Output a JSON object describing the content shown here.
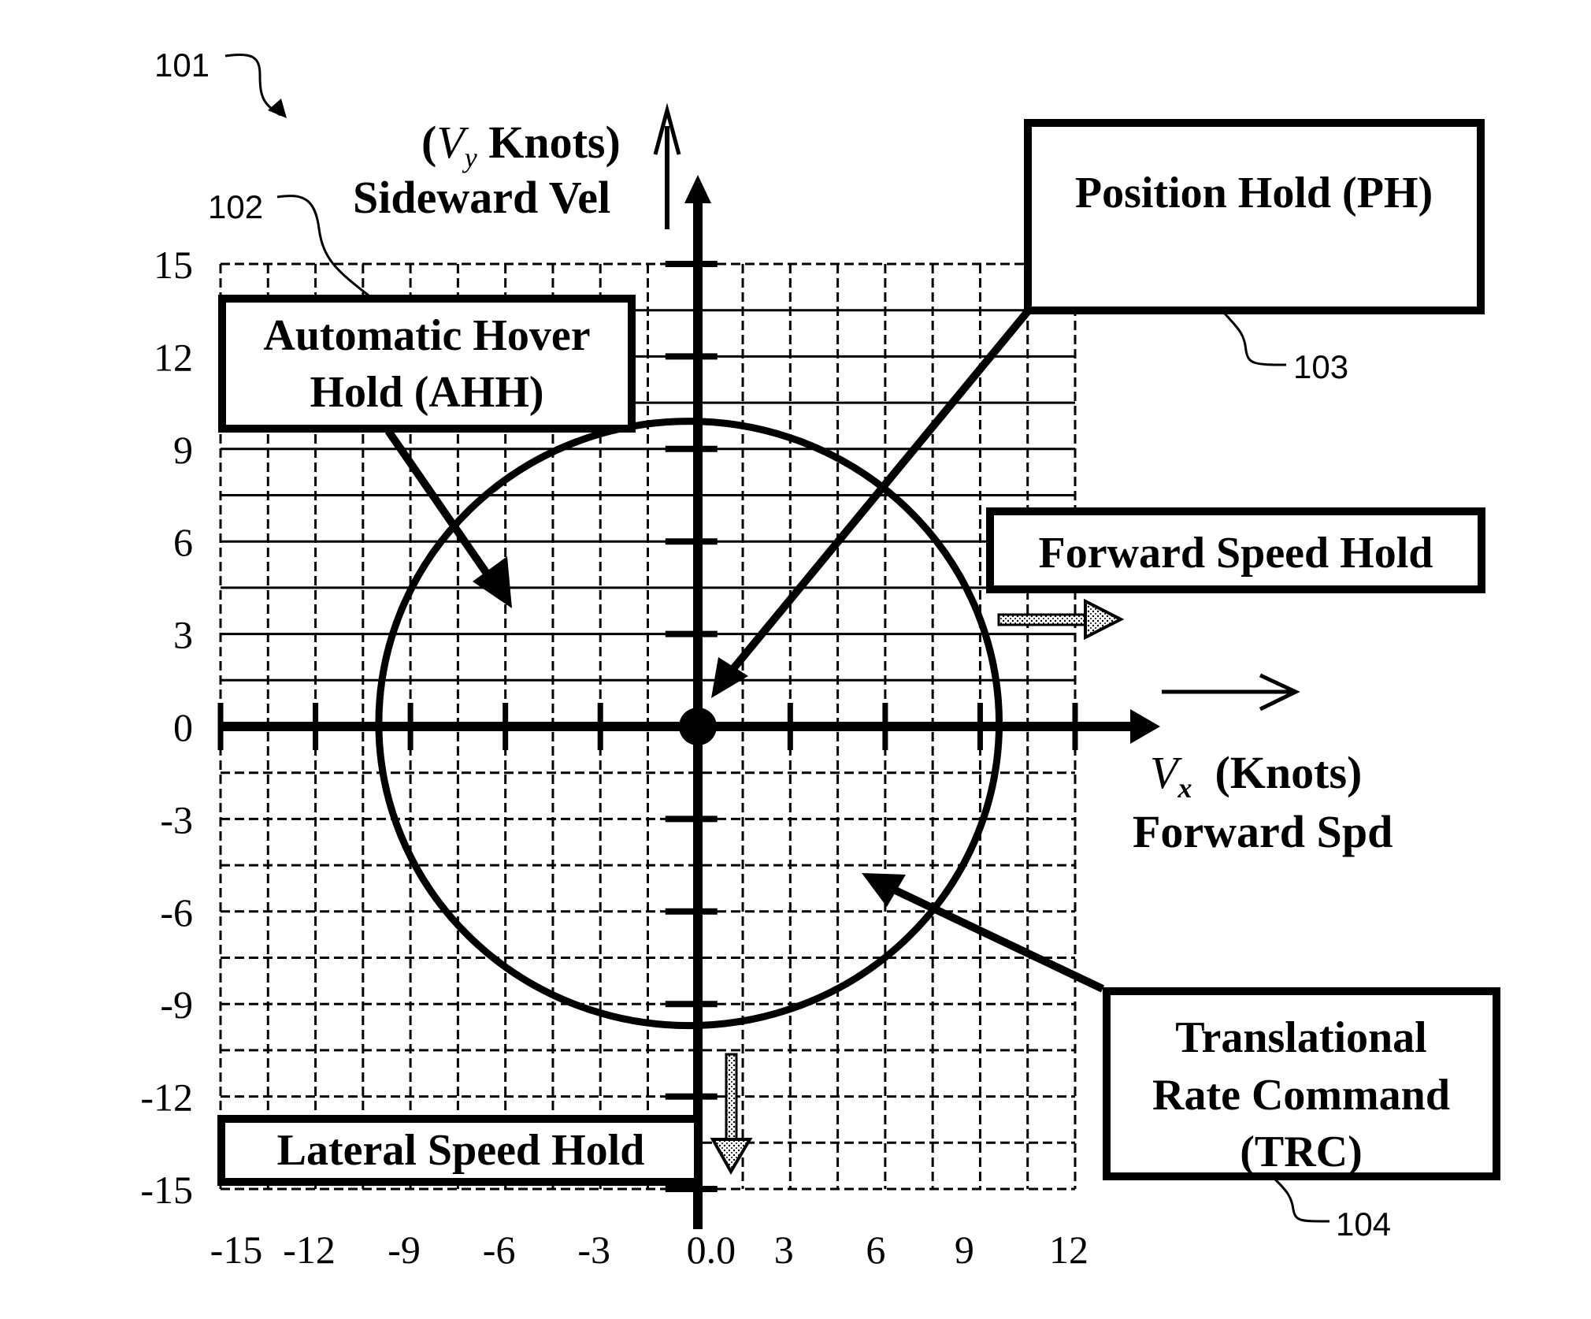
{
  "figure": {
    "reference_numbers": {
      "figure": "101",
      "ahh": "102",
      "ph": "103",
      "trc": "104"
    },
    "boxes": {
      "ahh": [
        "Automatic Hover",
        "Hold (AHH)"
      ],
      "ph": [
        "Position Hold (PH)"
      ],
      "forward_speed_hold": [
        "Forward Speed Hold"
      ],
      "lateral_speed_hold": [
        "Lateral Speed Hold"
      ],
      "trc": [
        "Translational",
        "Rate Command",
        "(TRC)"
      ]
    },
    "y_axis_title": {
      "line1_open": "(",
      "line1_var": "V",
      "line1_sub": "y",
      "line1_rest": " Knots)",
      "line2": "Sideward Vel"
    },
    "x_axis_title": {
      "line1_var": "V",
      "line1_sub": "x",
      "line1_rest": "  (Knots)",
      "line2": "Forward Spd"
    }
  },
  "chart_data": {
    "type": "scatter",
    "title": "",
    "xlabel": "Vx (Knots) Forward Spd",
    "ylabel": "(Vy Knots) Sideward Vel",
    "xlim": [
      -15,
      12
    ],
    "ylim": [
      -15,
      15
    ],
    "grid": true,
    "grid_step": 1.5,
    "x_ticks": [
      -15,
      -12,
      -9,
      -6,
      -3,
      0,
      3,
      6,
      9,
      12
    ],
    "x_tick_labels": [
      "-15",
      "-12",
      "-9",
      "-6",
      "-3",
      "0.0",
      "3",
      "6",
      "9",
      "12"
    ],
    "y_ticks": [
      15,
      12,
      9,
      6,
      3,
      0,
      -3,
      -6,
      -9,
      -12,
      -15
    ],
    "y_tick_labels": [
      "15",
      "12",
      "9",
      "6",
      "3",
      "0",
      "-3",
      "-6",
      "-9",
      "-12",
      "-15"
    ],
    "boundary_circle": {
      "center": [
        -0.2,
        0.1
      ],
      "radius": 9.8
    },
    "origin_point": {
      "x": 0,
      "y": 0,
      "label": "Position Hold (PH)"
    },
    "regions": [
      {
        "name": "Automatic Hover Hold (AHH)",
        "pointer_to": [
          -6.0,
          3.9
        ]
      },
      {
        "name": "Position Hold (PH)",
        "pointer_to": [
          0.5,
          0.9
        ]
      },
      {
        "name": "Translational Rate Command (TRC)",
        "pointer_to": [
          5.3,
          -4.8
        ]
      },
      {
        "name": "Forward Speed Hold",
        "direction": "+x",
        "beyond_radius": true
      },
      {
        "name": "Lateral Speed Hold",
        "direction": "-y",
        "beyond_radius": true
      }
    ]
  }
}
